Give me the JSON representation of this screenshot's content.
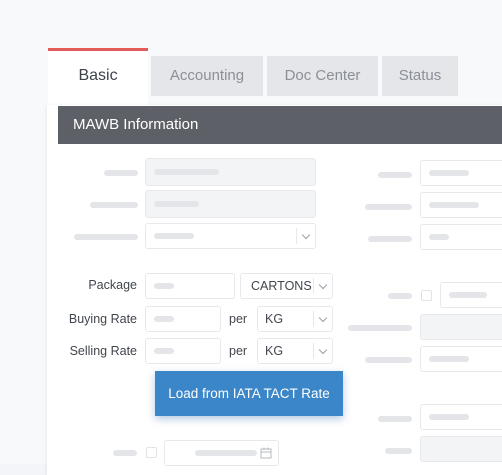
{
  "tabs": [
    {
      "label": "Basic"
    },
    {
      "label": "Accounting"
    },
    {
      "label": "Doc Center"
    },
    {
      "label": "Status"
    }
  ],
  "panel": {
    "title": "MAWB Information"
  },
  "form": {
    "package_label": "Package",
    "package_unit": "CARTONS",
    "buying_rate_label": "Buying Rate",
    "buying_per": "per",
    "buying_unit": "KG",
    "selling_rate_label": "Selling Rate",
    "selling_per": "per",
    "selling_unit": "KG"
  },
  "actions": {
    "load_tact": "Load from IATA TACT Rate"
  },
  "icons": [
    "chevron-down-icon",
    "calendar-icon",
    "checkbox-icon"
  ],
  "colors": {
    "active_tab_accent": "#e25b59",
    "header_bg": "#5d6167",
    "button_bg": "#3b86c8"
  }
}
